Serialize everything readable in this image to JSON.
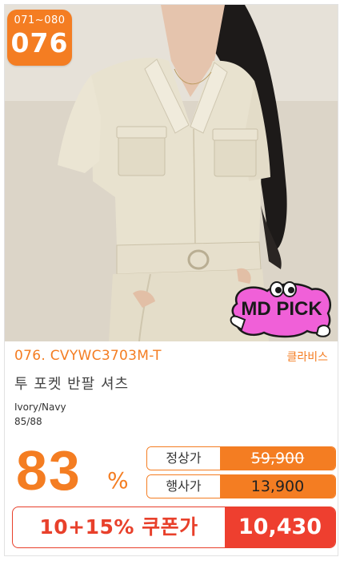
{
  "badge": {
    "range": "071~080",
    "number": "076"
  },
  "md_pick": {
    "label": "MD PICK",
    "colors": {
      "pink": "#f060d8",
      "outline": "#1a1a1a"
    }
  },
  "product": {
    "code": "076. CVYWC3703M-T",
    "brand": "클라비스",
    "name": "투 포켓 반팔 셔츠",
    "colors_option": "Ivory/Navy",
    "sizes_option": "85/88"
  },
  "pricing": {
    "discount_value": "83",
    "discount_unit": "%",
    "regular_label": "정상가",
    "regular_price": "59,900",
    "event_label": "행사가",
    "event_price": "13,900",
    "coupon_label": "10+15% 쿠폰가",
    "coupon_price": "10,430"
  },
  "theme": {
    "accent": "#f47d22",
    "coupon_red": "#ee3f2f"
  }
}
